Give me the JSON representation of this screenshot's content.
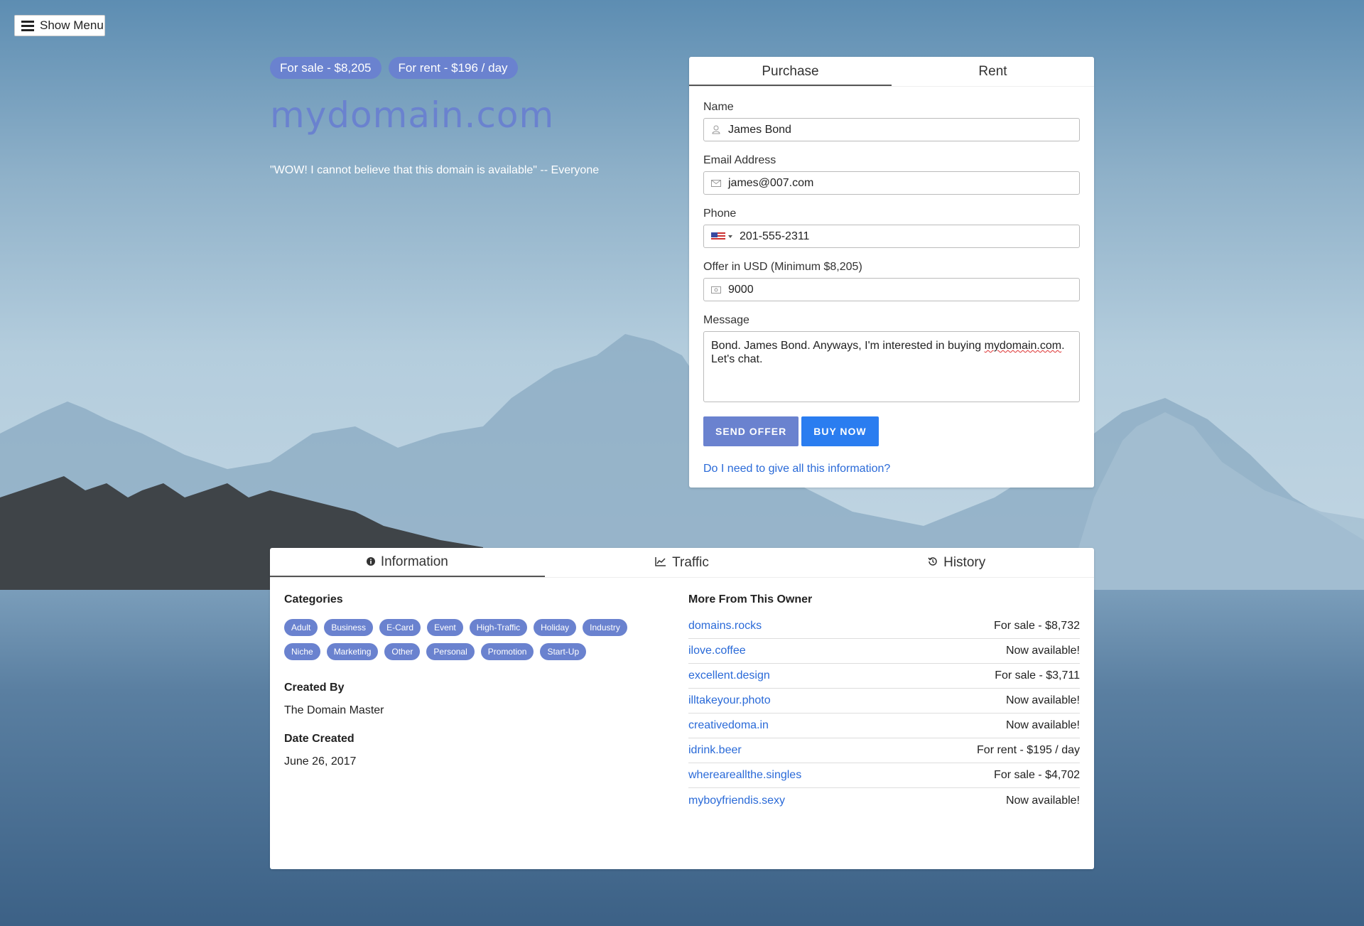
{
  "menu": {
    "label": "Show Menu"
  },
  "hero": {
    "sale_pill": "For sale - $8,205",
    "rent_pill": "For rent - $196 / day",
    "domain": "mydomain.com",
    "tagline": "\"WOW! I cannot believe that this domain is available\" -- Everyone"
  },
  "purchase": {
    "tabs": [
      "Purchase",
      "Rent"
    ],
    "active_tab": "Purchase",
    "name_label": "Name",
    "name_value": "James Bond",
    "email_label": "Email Address",
    "email_value": "james@007.com",
    "phone_label": "Phone",
    "phone_value": "201-555-2311",
    "offer_label": "Offer in USD (Minimum $8,205)",
    "offer_value": "9000",
    "message_label": "Message",
    "message_value_a": "Bond. James Bond. Anyways, I'm interested in buying ",
    "message_value_link": "mydomain.com",
    "message_value_b": ". Let's chat.",
    "send_offer": "SEND OFFER",
    "buy_now": "BUY NOW",
    "info_link": "Do I need to give all this information?"
  },
  "info": {
    "tabs": [
      "Information",
      "Traffic",
      "History"
    ],
    "active_tab": "Information",
    "categories_title": "Categories",
    "categories": [
      "Adult",
      "Business",
      "E-Card",
      "Event",
      "High-Traffic",
      "Holiday",
      "Industry",
      "Niche",
      "Marketing",
      "Other",
      "Personal",
      "Promotion",
      "Start-Up"
    ],
    "created_by_title": "Created By",
    "created_by": "The Domain Master",
    "date_created_title": "Date Created",
    "date_created": "June 26, 2017",
    "more_title": "More From This Owner",
    "owner_domains": [
      {
        "domain": "domains.rocks",
        "status": "For sale - $8,732"
      },
      {
        "domain": "ilove.coffee",
        "status": "Now available!"
      },
      {
        "domain": "excellent.design",
        "status": "For sale - $3,711"
      },
      {
        "domain": "illtakeyour.photo",
        "status": "Now available!"
      },
      {
        "domain": "creativedoma.in",
        "status": "Now available!"
      },
      {
        "domain": "idrink.beer",
        "status": "For rent - $195 / day"
      },
      {
        "domain": "whereareallthe.singles",
        "status": "For sale - $4,702"
      },
      {
        "domain": "myboyfriendis.sexy",
        "status": "Now available!"
      }
    ]
  },
  "colors": {
    "accent": "#6a82cf",
    "primary": "#2a7df0",
    "link": "#2a6ad8"
  },
  "icons": [
    "hamburger-icon",
    "user-icon",
    "envelope-icon",
    "us-flag-icon",
    "money-icon",
    "info-circle-icon",
    "line-chart-icon",
    "history-icon"
  ]
}
